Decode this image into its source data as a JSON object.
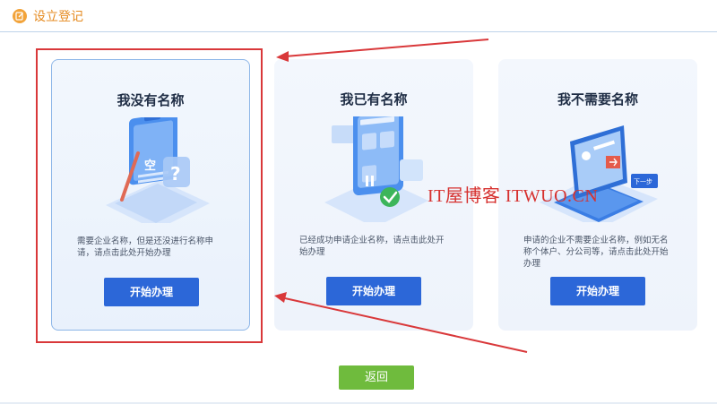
{
  "header": {
    "title": "设立登记",
    "icon": "edit-icon",
    "accent": "#e58a1f"
  },
  "cards": [
    {
      "title": "我没有名称",
      "description": "需要企业名称，但是还没进行名称申请，请点击此处开始办理",
      "button": "开始办理",
      "illustration": "clipboard-illustration",
      "selected": true
    },
    {
      "title": "我已有名称",
      "description": "已经成功申请企业名称，请点击此处开始办理",
      "button": "开始办理",
      "illustration": "phone-approved-illustration",
      "selected": false
    },
    {
      "title": "我不需要名称",
      "description": "申请的企业不需要企业名称，例如无名称个体户、分公司等，请点击此处开始办理",
      "button": "开始办理",
      "illustration": "laptop-illustration",
      "selected": false
    }
  ],
  "watermark": "IT屋博客 ITWUO.CN",
  "back_button": "返回",
  "colors": {
    "primary_button": "#2c67d8",
    "back_button": "#6fbb3d",
    "annotation": "#d9383a"
  }
}
